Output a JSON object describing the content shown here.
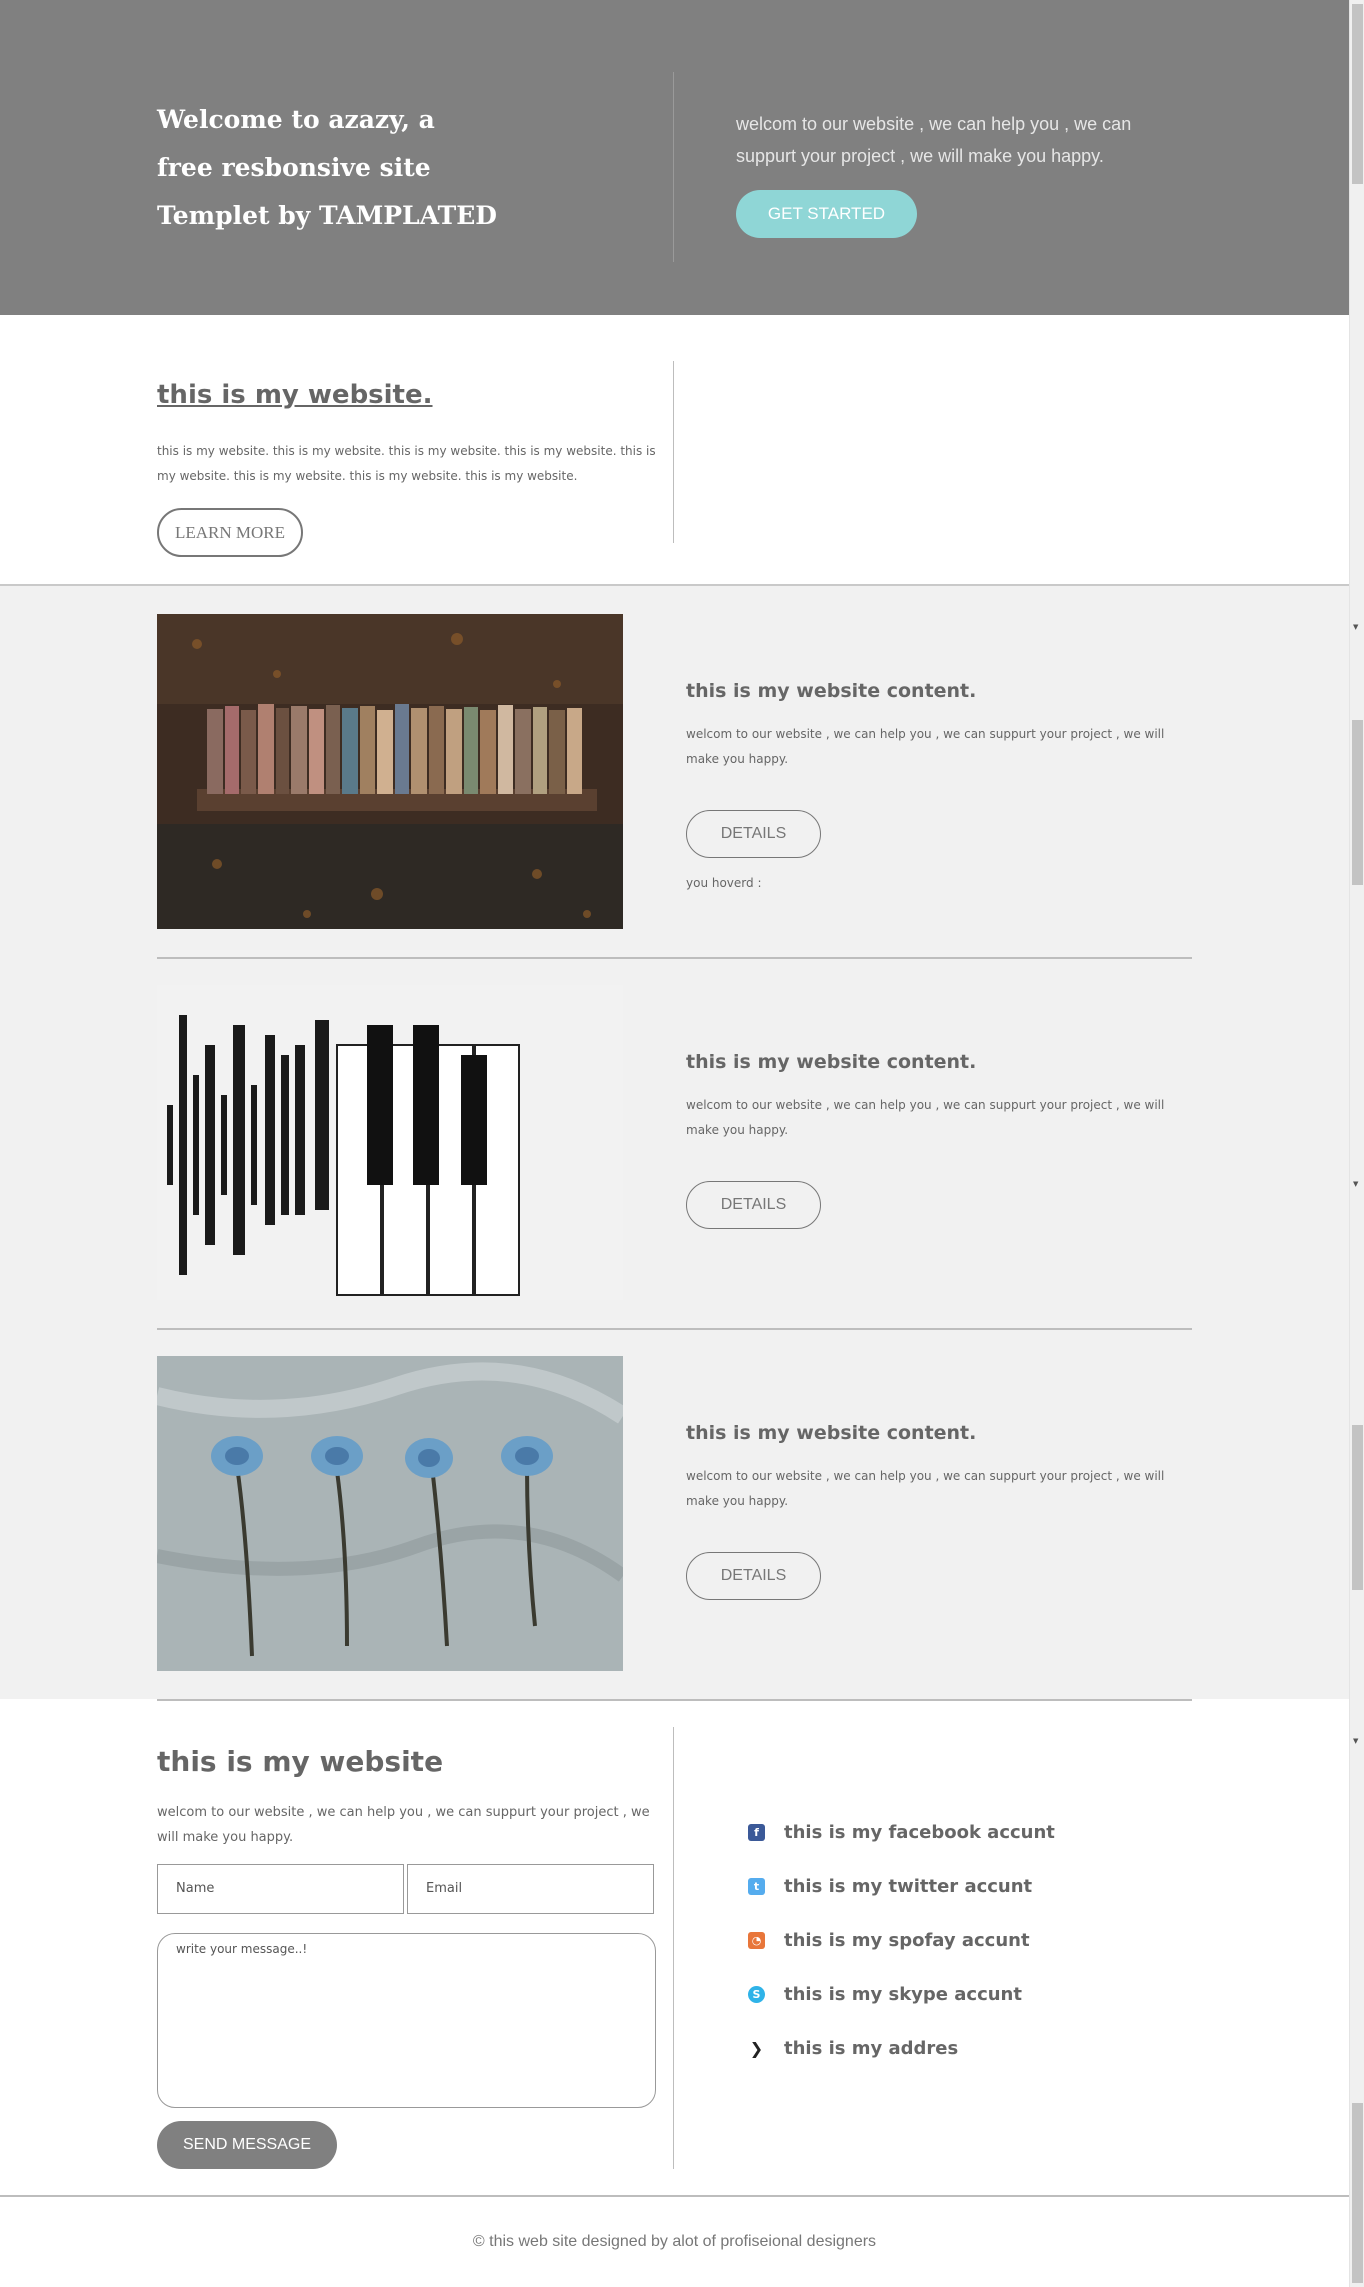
{
  "hero": {
    "title": "Welcome to azazy, a free resbonsive site Templet by TAMPLATED",
    "text": "welcom to our website , we can help you , we can suppurt your project , we will make you happy.",
    "button": "GET STARTED"
  },
  "intro": {
    "title": "this is my website.",
    "text": "this is my website. this is my website. this is my website. this is my website. this is my website. this is my website. this is my website. this is my website.",
    "button": "LEARN MORE"
  },
  "items": [
    {
      "title": "this is my website content.",
      "text": "welcom to our website , we can help you , we can suppurt your project , we will make you happy.",
      "button": "DETAILS",
      "hover": "you hoverd :",
      "image": "books-on-bench-photo"
    },
    {
      "title": "this is my website content.",
      "text": "welcom to our website , we can help you , we can suppurt your project , we will make you happy.",
      "button": "DETAILS",
      "image": "soundwave-piano-photo"
    },
    {
      "title": "this is my website content.",
      "text": "welcom to our website , we can help you , we can suppurt your project , we will make you happy.",
      "button": "DETAILS",
      "image": "blue-roses-photo"
    }
  ],
  "contact": {
    "title": "this is my website",
    "text": "welcom to our website , we can help you , we can suppurt your project , we will make you happy.",
    "name_placeholder": "Name",
    "email_placeholder": "Email",
    "message_placeholder": "write your message..!",
    "button": "SEND MESSAGE"
  },
  "social": [
    {
      "label": "this is my facebook accunt",
      "icon": "facebook-icon",
      "color": "#3b5998",
      "glyph": "f"
    },
    {
      "label": "this is my twitter accunt",
      "icon": "twitter-icon",
      "color": "#55acee",
      "glyph": "t"
    },
    {
      "label": "this is my spofay accunt",
      "icon": "rss-icon",
      "color": "#e8763a",
      "glyph": "◔"
    },
    {
      "label": "this is my skype accunt",
      "icon": "skype-icon",
      "color": "#2fb3e8",
      "glyph": "S"
    },
    {
      "label": "this is my addres",
      "icon": "chevron-right-icon",
      "color": "#222222",
      "glyph": "❯"
    }
  ],
  "footer": {
    "text": "© this web site designed by alot of profiseional designers"
  }
}
